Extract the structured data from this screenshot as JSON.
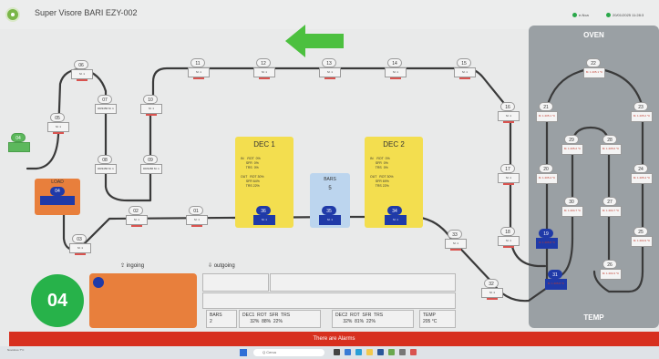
{
  "header": {
    "title": "Super Visore BARI EZY-002",
    "status_online": "e-Nca",
    "status_date": "20/01/2025 11:28:3"
  },
  "oven": {
    "title": "OVEN",
    "temp_title": "TEMP"
  },
  "stations": {
    "s06": {
      "num": "06",
      "label": "M. 1"
    },
    "s05": {
      "num": "05",
      "label": "M. 1"
    },
    "s04": {
      "num": "04",
      "label": ""
    },
    "s07": {
      "num": "07",
      "label": "DR3456 M. 1"
    },
    "s08": {
      "num": "08",
      "label": "DR3456 M. 1"
    },
    "s09": {
      "num": "09",
      "label": "DR3456 M. 1"
    },
    "s10": {
      "num": "10",
      "label": "M. 1"
    },
    "s11": {
      "num": "11",
      "label": "M. 1"
    },
    "s12": {
      "num": "12",
      "label": "M. 1"
    },
    "s13": {
      "num": "13",
      "label": "M. 1"
    },
    "s14": {
      "num": "14",
      "label": "M. 1"
    },
    "s15": {
      "num": "15",
      "label": "M. 1"
    },
    "s16": {
      "num": "16",
      "label": "M. 1"
    },
    "s17": {
      "num": "17",
      "label": "M. 1"
    },
    "s18": {
      "num": "18",
      "label": "M. 1"
    },
    "s19": {
      "num": "19",
      "label": "M. 1 205.8 °C"
    },
    "s20": {
      "num": "20",
      "label": "M. 1 205.4 °C"
    },
    "s21": {
      "num": "21",
      "label": "M. 1 205.1 °C"
    },
    "s22": {
      "num": "22",
      "label": "M. 1 205.1 °C"
    },
    "s23": {
      "num": "23",
      "label": "M. 1 205.2 °C"
    },
    "s24": {
      "num": "24",
      "label": "M. 1 205.4 °C"
    },
    "s25": {
      "num": "25",
      "label": "M. 1 204.9 °C"
    },
    "s26": {
      "num": "26",
      "label": "M. 1 204.3 °C"
    },
    "s27": {
      "num": "27",
      "label": "M. 1 204.7 °C"
    },
    "s28": {
      "num": "28",
      "label": "M. 1 205.0 °C"
    },
    "s29": {
      "num": "29",
      "label": "M. 1 205.2 °C"
    },
    "s30": {
      "num": "30",
      "label": "M. 1 204.7 °C"
    },
    "s31": {
      "num": "31",
      "label": "M. 1 205.8 °C"
    },
    "s32": {
      "num": "32",
      "label": "M. 1"
    },
    "s33": {
      "num": "33",
      "label": "M. 1"
    },
    "s36": {
      "num": "36",
      "label": "M. 1"
    },
    "s35": {
      "num": "35",
      "label": "M. 1"
    },
    "s34": {
      "num": "34",
      "label": "M. 1"
    },
    "s01": {
      "num": "01",
      "label": "M. 1"
    },
    "s02": {
      "num": "02",
      "label": "M. 1"
    },
    "s03": {
      "num": "03",
      "label": "M. 1"
    }
  },
  "dec1": {
    "title": "DEC 1",
    "info": "IN    ROT  0%\n      SFR  0%\n      TRS  0%\n\nOUT   ROT 30%\n      SFR 64%\n      TRS 22%"
  },
  "dec2": {
    "title": "DEC 2",
    "info": "IN    ROT  0%\n      SFR  0%\n      TRS  0%\n\nOUT   ROT 30%\n      SFR 69%\n      TRS 22%"
  },
  "bars": {
    "title": "BARS",
    "value": "5"
  },
  "load": {
    "title": "LOAD",
    "num": "04"
  },
  "current_station": "04",
  "ingoing_label": "ingoing",
  "outgoing_label": "outgoing",
  "summary": {
    "bars": "BARS\n2",
    "dec1": "DEC1  ROT  SFR  TRS\n      32%  88%  22%",
    "dec2": "DEC2  ROT  SFR  TRS\n      32%  81%  22%",
    "temp": "TEMP\n205 °C"
  },
  "alarm_text": "There are Alarms",
  "taskbar": {
    "weather": "Nuvoloso\n7°C",
    "search": "Q Cerca"
  },
  "colors": {
    "line": "#3a3a3a",
    "station_blue": "#1f3aa8",
    "oven": "#9aa0a4",
    "dec": "#f3de4f",
    "alarm": "#d7301f",
    "load": "#e87f3c",
    "green": "#27b24a"
  }
}
